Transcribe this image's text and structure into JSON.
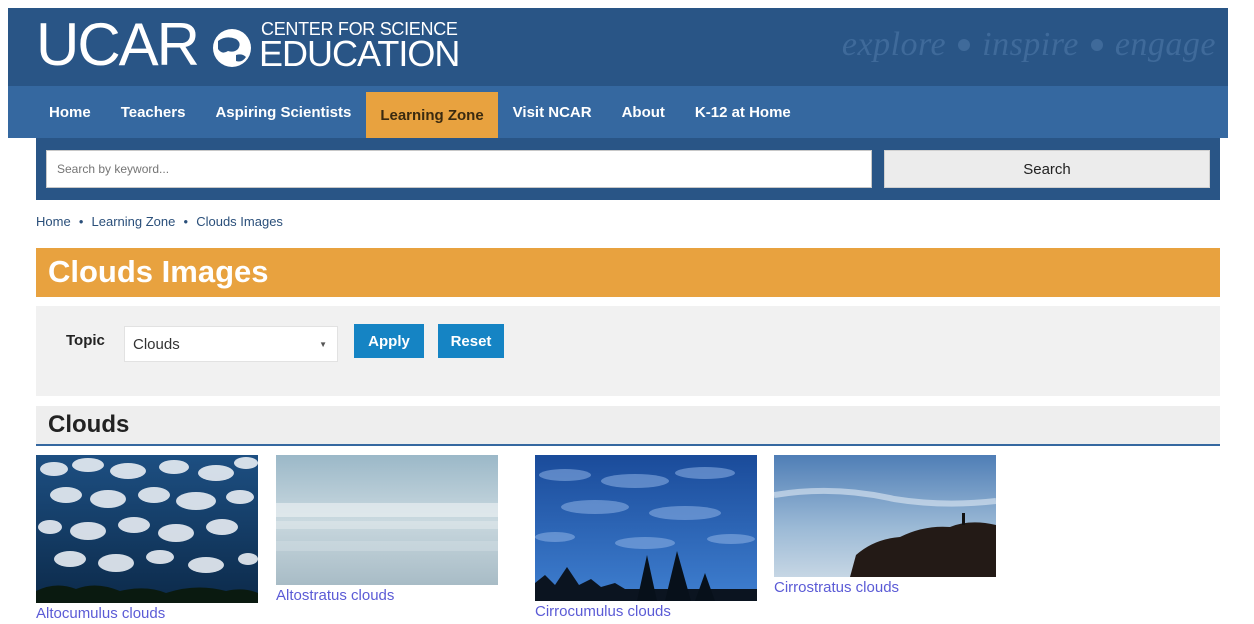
{
  "header": {
    "logo_main": "UCAR",
    "logo_line1": "CENTER FOR SCIENCE",
    "logo_line2": "EDUCATION",
    "tagline": [
      "explore",
      "inspire",
      "engage"
    ]
  },
  "nav": {
    "items": [
      {
        "label": "Home"
      },
      {
        "label": "Teachers"
      },
      {
        "label": "Aspiring Scientists"
      },
      {
        "label": "Learning Zone"
      },
      {
        "label": "Visit NCAR"
      },
      {
        "label": "About"
      },
      {
        "label": "K-12 at Home"
      }
    ],
    "active": "Learning Zone"
  },
  "search": {
    "placeholder": "Search by keyword...",
    "button_label": "Search"
  },
  "breadcrumb": [
    "Home",
    "Learning Zone",
    "Clouds Images"
  ],
  "page_title": "Clouds Images",
  "filter": {
    "topic_label": "Topic",
    "topic_value": "Clouds",
    "apply_label": "Apply",
    "reset_label": "Reset"
  },
  "section_title": "Clouds",
  "gallery": [
    {
      "caption": "Altocumulus clouds"
    },
    {
      "caption": "Altostratus clouds"
    },
    {
      "caption": "Cirrocumulus clouds"
    },
    {
      "caption": "Cirrostratus clouds"
    }
  ],
  "colors": {
    "header_bg": "#295586",
    "nav_bg": "#3568a0",
    "accent_orange": "#e8a23f",
    "button_blue": "#1584c4",
    "link": "#5b5bd6"
  }
}
